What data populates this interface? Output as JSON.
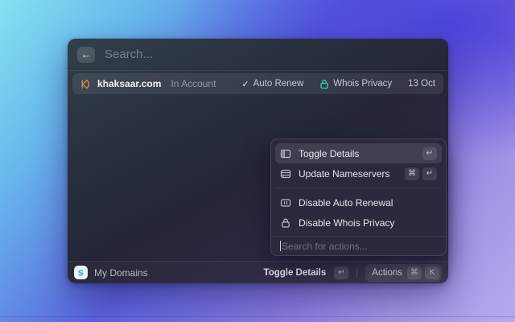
{
  "window": {
    "search_placeholder": "Search...",
    "row": {
      "domain": "khaksaar.com",
      "status": "In Account",
      "auto_renew_label": "Auto Renew",
      "whois_privacy_label": "Whois Privacy",
      "date": "13 Oct",
      "check_glyph": "✓"
    },
    "actions_menu": {
      "items": [
        {
          "label": "Toggle Details",
          "keys": [
            "↵"
          ]
        },
        {
          "label": "Update Nameservers",
          "keys": [
            "⌘",
            "↵"
          ]
        },
        {
          "label": "Disable Auto Renewal",
          "keys": []
        },
        {
          "label": "Disable Whois Privacy",
          "keys": []
        }
      ],
      "search_placeholder": "Search for actions..."
    },
    "footer": {
      "source_label": "My Domains",
      "primary_action_label": "Toggle Details",
      "primary_action_key": "↵",
      "actions_label": "Actions",
      "actions_key_cmd": "⌘",
      "actions_key_letter": "K"
    },
    "header": {
      "back_glyph": "←"
    },
    "colors": {
      "whois_lock": "#2fd3a5",
      "domain_icon": "#d98e4f",
      "app_icon_s": "#2fa8c8"
    }
  }
}
